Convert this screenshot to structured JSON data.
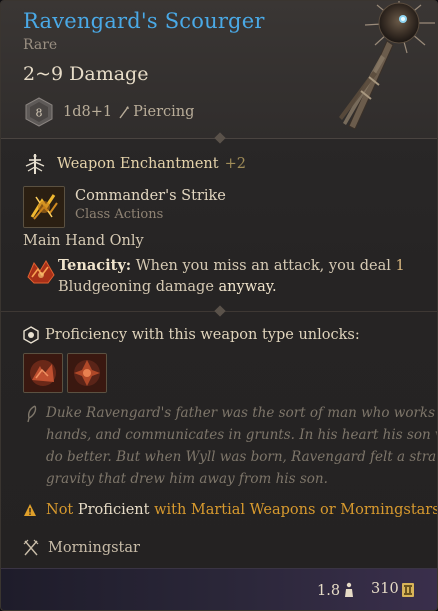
{
  "item": {
    "name": "Ravengard's Scourger",
    "rarity": "Rare",
    "damage": "2~9 Damage",
    "die_face": "8",
    "dice": "1d8+1",
    "damage_type": "Piercing"
  },
  "enchantment": {
    "label": "Weapon Enchantment",
    "bonus": "+2"
  },
  "action": {
    "name": "Commander's Strike",
    "category": "Class Actions"
  },
  "main_hand": "Main Hand Only",
  "tenacity": {
    "keyword": "Tenacity:",
    "text_1": " When you miss an attack, you deal ",
    "number": "1",
    "text_2": "Bludgeoning damage",
    "text_3": " anyway."
  },
  "proficiency_unlock": {
    "label": "Proficiency with this weapon type unlocks:",
    "icons": [
      "ability-icon-1",
      "ability-icon-2"
    ]
  },
  "lore": {
    "lines": [
      "Duke Ravengard's father was the sort of man who works with his",
      "hands, and communicates in grunts. In his heart his son vowed to",
      "do better. But when Wyll was born, Ravengard felt a strange",
      "gravity that drew him away from his son."
    ]
  },
  "proficiency_warning": {
    "not": "Not",
    "proficient": " Proficient ",
    "rest": "with Martial Weapons or Morningstars"
  },
  "weapon_type": "Morningstar",
  "footer": {
    "weight": "1.8",
    "price": "310"
  },
  "colors": {
    "name": "#4aa9e6",
    "warning": "#d89a2e",
    "enchant_bonus": "#a08c58"
  }
}
